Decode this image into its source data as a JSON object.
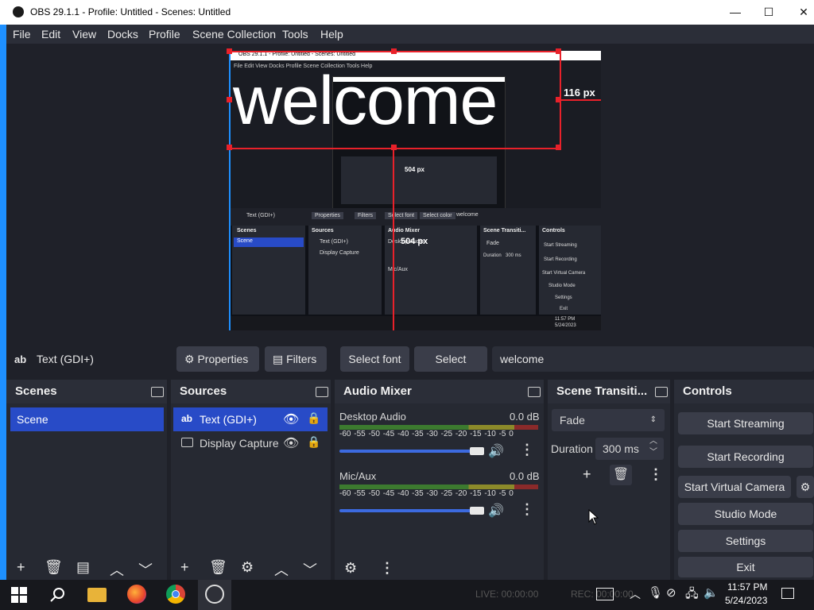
{
  "window": {
    "title": "OBS 29.1.1 - Profile: Untitled - Scenes: Untitled",
    "min": "—",
    "max": "☐",
    "close": "✕"
  },
  "menu": [
    "File",
    "Edit",
    "View",
    "Docks",
    "Profile",
    "Scene Collection",
    "Tools",
    "Help"
  ],
  "preview": {
    "text": "welcome",
    "measure_right": "116 px",
    "measure_bottom": "504 px",
    "nested_menu": "File  Edit  View  Docks  Profile  Scene Collection  Tools  Help",
    "nested_title": "OBS 29.1.1 - Profile: Untitled - Scenes: Untitled",
    "nested_source": "Text (GDI+)",
    "nested_buttons": [
      "Properties",
      "Filters",
      "Select font",
      "Select color",
      "welcome"
    ],
    "nested_docks": [
      "Scenes",
      "Sources",
      "Audio Mixer",
      "Scene Transiti...",
      "Controls"
    ],
    "nested_scene": "Scene",
    "nested_sources": [
      "Text (GDI+)",
      "Display Capture"
    ],
    "nested_mixer": [
      "Desktop Audio",
      "Mic/Aux"
    ],
    "nested_transition": [
      "Fade",
      "Duration",
      "300 ms"
    ],
    "nested_controls": [
      "Start Streaming",
      "Start Recording",
      "Start Virtual Camera",
      "Studio Mode",
      "Settings",
      "Exit"
    ],
    "nested_time": "11:57 PM",
    "nested_date": "5/24/2023"
  },
  "source_toolbar": {
    "source_icon": "ab",
    "source_name": "Text (GDI+)",
    "properties": "Properties",
    "filters": "Filters",
    "select_font": "Select font",
    "select_color": "Select color",
    "text_value": "welcome"
  },
  "docks": {
    "scenes": {
      "title": "Scenes",
      "items": [
        "Scene"
      ]
    },
    "sources": {
      "title": "Sources",
      "items": [
        {
          "label": "Text (GDI+)",
          "icon": "text-icon"
        },
        {
          "label": "Display Capture",
          "icon": "monitor-icon"
        }
      ]
    },
    "mixer": {
      "title": "Audio Mixer",
      "channels": [
        {
          "name": "Desktop Audio",
          "db": "0.0 dB"
        },
        {
          "name": "Mic/Aux",
          "db": "0.0 dB"
        }
      ],
      "ticks": [
        "-60",
        "-55",
        "-50",
        "-45",
        "-40",
        "-35",
        "-30",
        "-25",
        "-20",
        "-15",
        "-10",
        "-5",
        "0"
      ]
    },
    "transitions": {
      "title": "Scene Transiti...",
      "type": "Fade",
      "duration_label": "Duration",
      "duration_value": "300 ms"
    },
    "controls": {
      "title": "Controls",
      "buttons": [
        "Start Streaming",
        "Start Recording",
        "Start Virtual Camera",
        "Studio Mode",
        "Settings",
        "Exit"
      ]
    }
  },
  "taskbar": {
    "time": "11:57 PM",
    "date": "5/24/2023",
    "status": "LIVE: 00:00:00",
    "rec_status": "REC: 00:00:00"
  },
  "colors": {
    "accent": "#284bc7",
    "selection": "#e8212a",
    "dock_bg": "#262932",
    "window_bg": "#1f2129"
  }
}
